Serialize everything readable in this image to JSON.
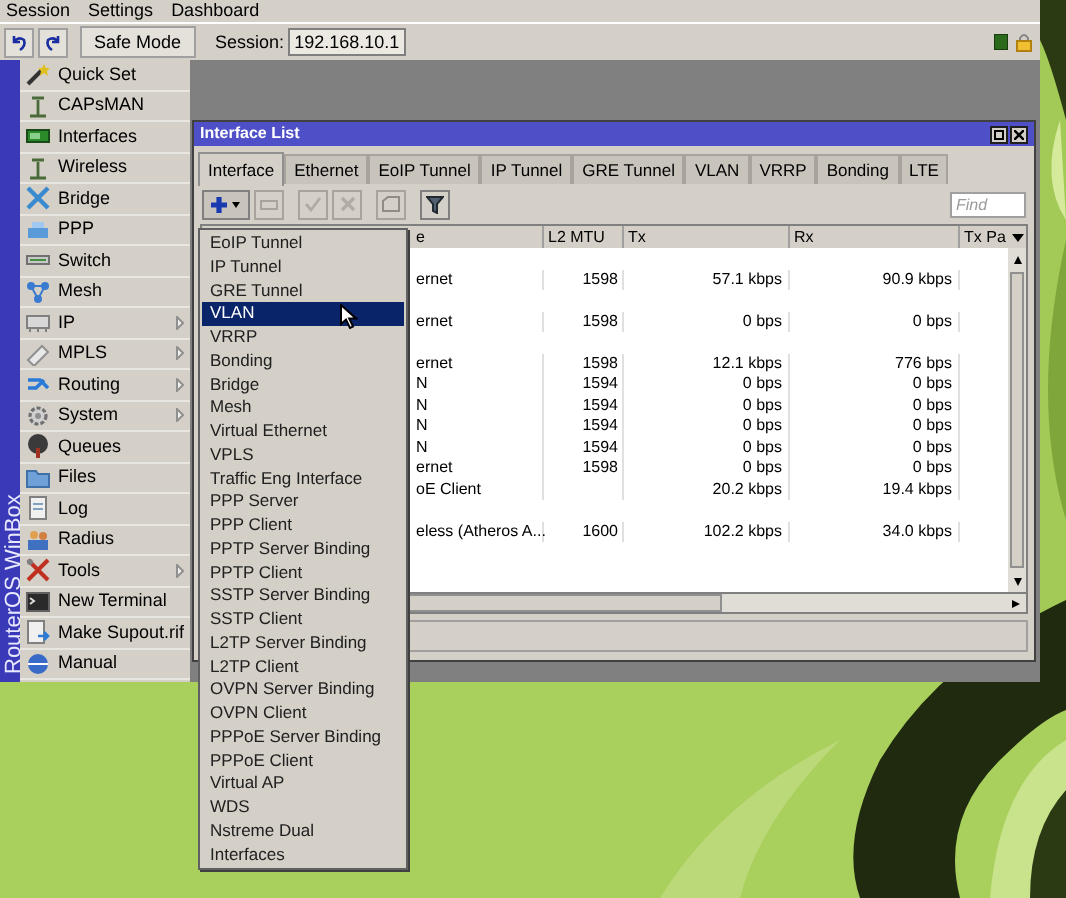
{
  "menubar": [
    "Session",
    "Settings",
    "Dashboard"
  ],
  "toolbar": {
    "safe_mode": "Safe Mode",
    "session_label": "Session:",
    "session_value": "192.168.10.1"
  },
  "sidebar": {
    "brand": "RouterOS WinBox",
    "items": [
      {
        "label": "Quick Set",
        "has_submenu": false
      },
      {
        "label": "CAPsMAN",
        "has_submenu": false
      },
      {
        "label": "Interfaces",
        "has_submenu": false
      },
      {
        "label": "Wireless",
        "has_submenu": false
      },
      {
        "label": "Bridge",
        "has_submenu": false
      },
      {
        "label": "PPP",
        "has_submenu": false
      },
      {
        "label": "Switch",
        "has_submenu": false
      },
      {
        "label": "Mesh",
        "has_submenu": false
      },
      {
        "label": "IP",
        "has_submenu": true
      },
      {
        "label": "MPLS",
        "has_submenu": true
      },
      {
        "label": "Routing",
        "has_submenu": true
      },
      {
        "label": "System",
        "has_submenu": true
      },
      {
        "label": "Queues",
        "has_submenu": false
      },
      {
        "label": "Files",
        "has_submenu": false
      },
      {
        "label": "Log",
        "has_submenu": false
      },
      {
        "label": "Radius",
        "has_submenu": false
      },
      {
        "label": "Tools",
        "has_submenu": true
      },
      {
        "label": "New Terminal",
        "has_submenu": false
      },
      {
        "label": "Make Supout.rif",
        "has_submenu": false
      },
      {
        "label": "Manual",
        "has_submenu": false
      }
    ]
  },
  "interface_window": {
    "title": "Interface List",
    "tabs": [
      {
        "label": "Interface",
        "selected": true
      },
      {
        "label": "Ethernet",
        "selected": false
      },
      {
        "label": "EoIP Tunnel",
        "selected": false
      },
      {
        "label": "IP Tunnel",
        "selected": false
      },
      {
        "label": "GRE Tunnel",
        "selected": false
      },
      {
        "label": "VLAN",
        "selected": false
      },
      {
        "label": "VRRP",
        "selected": false
      },
      {
        "label": "Bonding",
        "selected": false
      },
      {
        "label": "LTE",
        "selected": false
      }
    ],
    "find_placeholder": "Find",
    "columns": {
      "type": "e",
      "l2mtu": "L2 MTU",
      "tx": "Tx",
      "rx": "Rx",
      "column_5": "Tx Pa"
    },
    "rows": [
      {
        "kind": "blank"
      },
      {
        "kind": "data",
        "type": "ernet",
        "l2mtu": "1598",
        "tx": "57.1 kbps",
        "rx": "90.9 kbps"
      },
      {
        "kind": "blank"
      },
      {
        "kind": "data",
        "type": "ernet",
        "l2mtu": "1598",
        "tx": "0 bps",
        "rx": "0 bps"
      },
      {
        "kind": "blank"
      },
      {
        "kind": "data",
        "type": "ernet",
        "l2mtu": "1598",
        "tx": "12.1 kbps",
        "rx": "776 bps"
      },
      {
        "kind": "data",
        "type": "N",
        "l2mtu": "1594",
        "tx": "0 bps",
        "rx": "0 bps"
      },
      {
        "kind": "data",
        "type": "N",
        "l2mtu": "1594",
        "tx": "0 bps",
        "rx": "0 bps"
      },
      {
        "kind": "data",
        "type": "N",
        "l2mtu": "1594",
        "tx": "0 bps",
        "rx": "0 bps"
      },
      {
        "kind": "data",
        "type": "N",
        "l2mtu": "1594",
        "tx": "0 bps",
        "rx": "0 bps"
      },
      {
        "kind": "data",
        "type": "ernet",
        "l2mtu": "1598",
        "tx": "0 bps",
        "rx": "0 bps"
      },
      {
        "kind": "data",
        "type": "oE Client",
        "tx": "20.2 kbps",
        "rx": "19.4 kbps"
      },
      {
        "kind": "blank"
      },
      {
        "kind": "data",
        "type": "eless (Atheros A...",
        "l2mtu": "1600",
        "tx": "102.2 kbps",
        "rx": "34.0 kbps"
      }
    ]
  },
  "add_menu": {
    "items": [
      {
        "label": "EoIP Tunnel",
        "selected": false
      },
      {
        "label": "IP Tunnel",
        "selected": false
      },
      {
        "label": "GRE Tunnel",
        "selected": false
      },
      {
        "label": "VLAN",
        "selected": true
      },
      {
        "label": "VRRP",
        "selected": false
      },
      {
        "label": "Bonding",
        "selected": false
      },
      {
        "label": "Bridge",
        "selected": false
      },
      {
        "label": "Mesh",
        "selected": false
      },
      {
        "label": "Virtual Ethernet",
        "selected": false
      },
      {
        "label": "VPLS",
        "selected": false
      },
      {
        "label": "Traffic Eng Interface",
        "selected": false
      },
      {
        "label": "PPP Server",
        "selected": false
      },
      {
        "label": "PPP Client",
        "selected": false
      },
      {
        "label": "PPTP Server Binding",
        "selected": false
      },
      {
        "label": "PPTP Client",
        "selected": false
      },
      {
        "label": "SSTP Server Binding",
        "selected": false
      },
      {
        "label": "SSTP Client",
        "selected": false
      },
      {
        "label": "L2TP Server Binding",
        "selected": false
      },
      {
        "label": "L2TP Client",
        "selected": false
      },
      {
        "label": "OVPN Server Binding",
        "selected": false
      },
      {
        "label": "OVPN Client",
        "selected": false
      },
      {
        "label": "PPPoE Server Binding",
        "selected": false
      },
      {
        "label": "PPPoE Client",
        "selected": false
      },
      {
        "label": "Virtual AP",
        "selected": false
      },
      {
        "label": "WDS",
        "selected": false
      },
      {
        "label": "Nstreme Dual",
        "selected": false
      },
      {
        "label": "Interfaces",
        "selected": false
      }
    ]
  }
}
